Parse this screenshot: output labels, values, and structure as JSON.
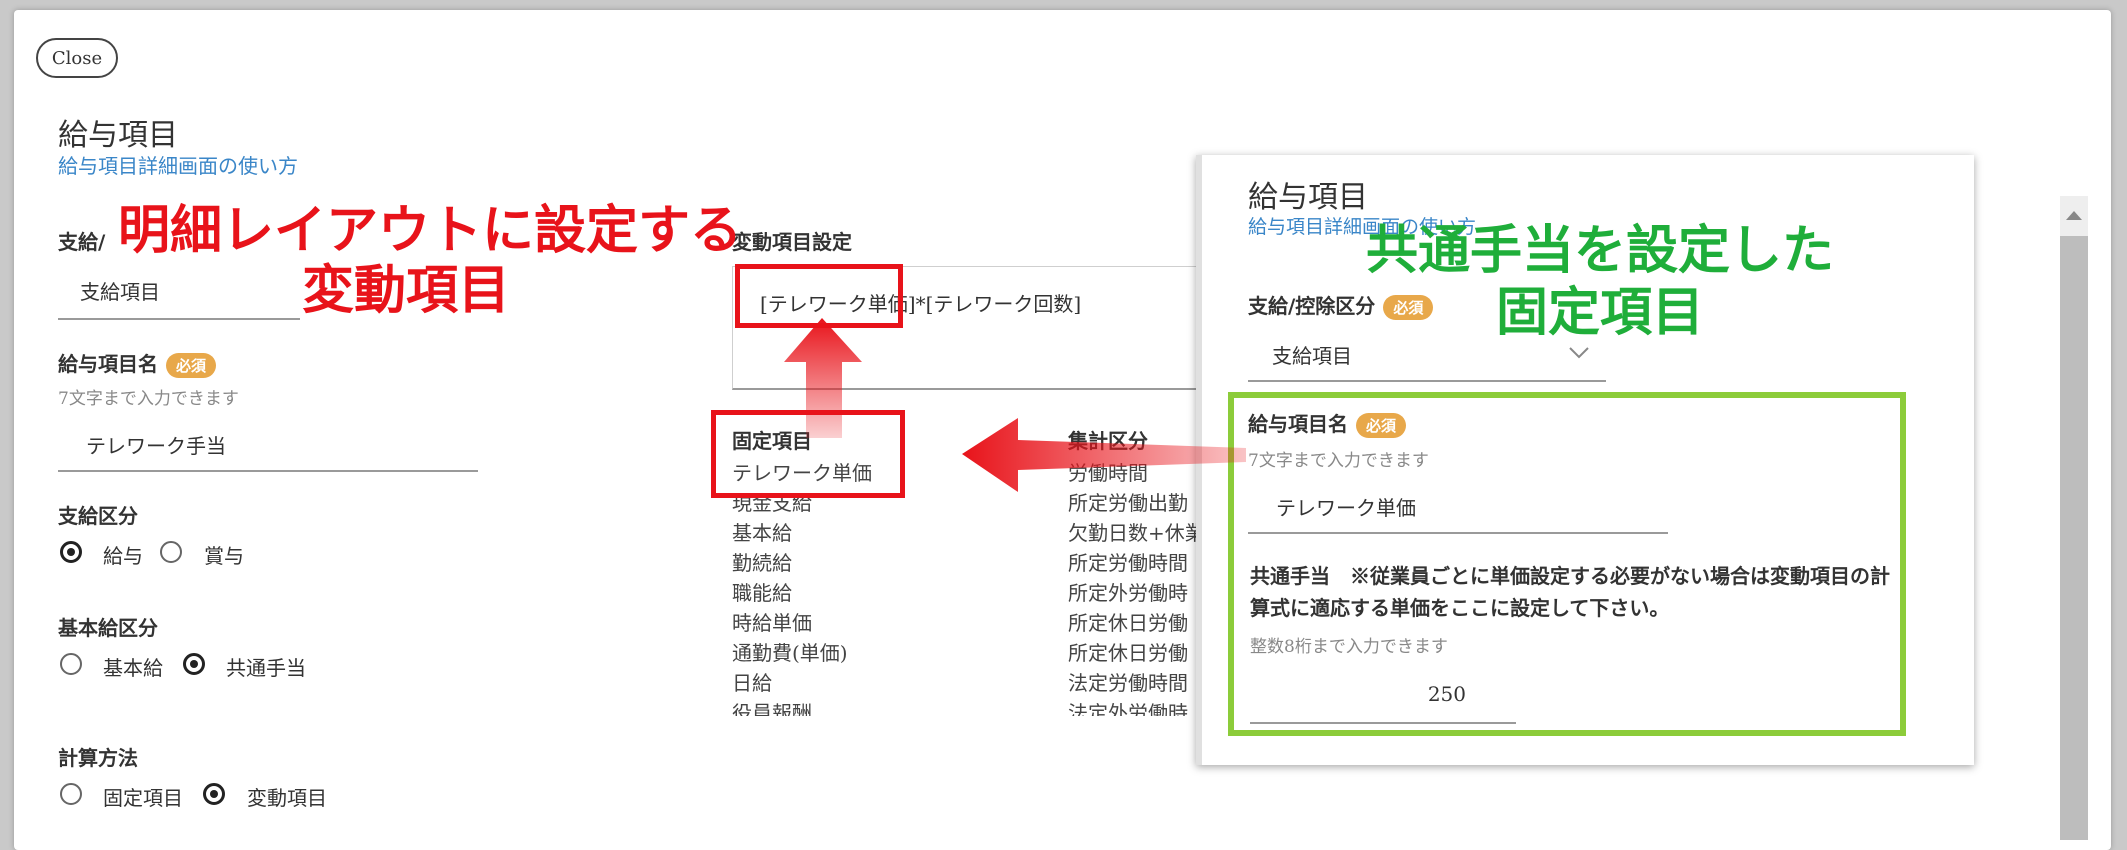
{
  "modal": {
    "close_label": "Close",
    "title": "給与項目",
    "help_link": "給与項目詳細画面の使い方",
    "pay_kind": {
      "label_visible": "支給/",
      "value": "支給項目"
    },
    "item_name": {
      "label": "給与項目名",
      "required": "必須",
      "hint": "7文字まで入力できます",
      "value": "テレワーク手当"
    },
    "pay_category": {
      "label": "支給区分",
      "options": [
        "給与",
        "賞与"
      ],
      "selected": "給与"
    },
    "base_category": {
      "label": "基本給区分",
      "options": [
        "基本給",
        "共通手当"
      ],
      "selected": "共通手当"
    },
    "calc_method": {
      "label": "計算方法",
      "options": [
        "固定項目",
        "変動項目"
      ],
      "selected": "変動項目"
    },
    "variable_settings": {
      "label": "変動項目設定",
      "formula": "[テレワーク単価]*[テレワーク回数]"
    },
    "fixed_items": {
      "label": "固定項目",
      "items": [
        "テレワーク単価",
        "現金支給",
        "基本給",
        "勤続給",
        "職能給",
        "時給単価",
        "通勤費(単価)",
        "日給",
        "役員報酬"
      ]
    },
    "aggregate": {
      "label": "集計区分",
      "items": [
        "労働時間",
        "所定労働出勤",
        "欠勤日数+休業",
        "所定労働時間",
        "所定外労働時",
        "所定休日労働",
        "所定休日労働",
        "法定労働時間",
        "法定外労働時"
      ]
    }
  },
  "popup": {
    "title": "給与項目",
    "help_link": "給与項目詳細画面の使い方",
    "pay_kind": {
      "label": "支給/控除区分",
      "required": "必須",
      "value": "支給項目"
    },
    "item_name": {
      "label": "給与項目名",
      "required": "必須",
      "hint": "7文字まで入力できます",
      "value": "テレワーク単価"
    },
    "common_allowance": {
      "label": "共通手当　※従業員ごとに単価設定する必要がない場合は変動項目の計算式に適応する単価をここに設定して下さい。",
      "hint": "整数8桁まで入力できます",
      "value": "250"
    }
  },
  "annotations": {
    "red_line1": "明細レイアウトに設定する",
    "red_line2": "変動項目",
    "green_line1": "共通手当を設定した",
    "green_line2": "固定項目"
  },
  "colors": {
    "accent_red": "#e8131a",
    "accent_green": "#8ccc3a",
    "link_blue": "#3a86c8",
    "badge_orange": "#e8a84a"
  }
}
